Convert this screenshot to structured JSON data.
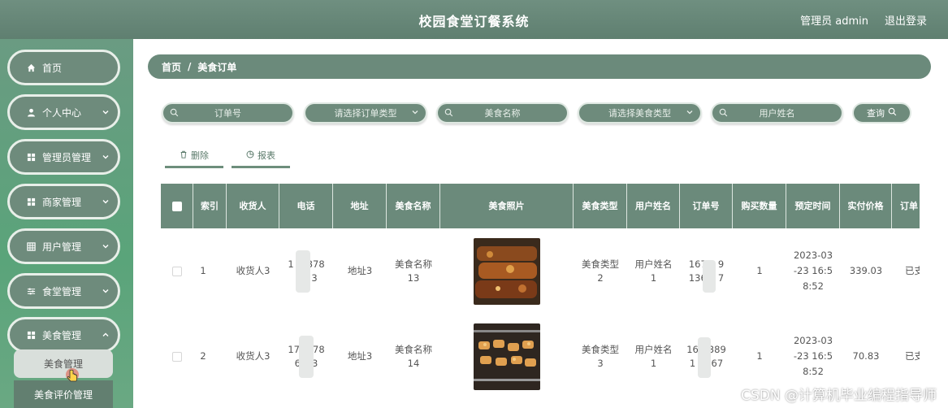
{
  "header": {
    "title": "校园食堂订餐系统",
    "admin": "管理员 admin",
    "logout": "退出登录"
  },
  "sidebar": {
    "items": [
      {
        "label": "首页",
        "icon": "home-icon"
      },
      {
        "label": "个人中心",
        "icon": "user-icon"
      },
      {
        "label": "管理员管理",
        "icon": "grid-icon"
      },
      {
        "label": "商家管理",
        "icon": "grid-icon"
      },
      {
        "label": "用户管理",
        "icon": "table-icon"
      },
      {
        "label": "食堂管理",
        "icon": "sliders-icon"
      },
      {
        "label": "美食管理",
        "icon": "grid-icon"
      }
    ],
    "sub_items": [
      "美食管理",
      "美食评价管理"
    ]
  },
  "breadcrumb": {
    "home": "首页",
    "separator": "/",
    "current": "美食订单"
  },
  "search": {
    "order_no": "订单号",
    "order_type": "请选择订单类型",
    "food_name": "美食名称",
    "food_type": "请选择美食类型",
    "user_name": "用户姓名",
    "button": "查询"
  },
  "actions": {
    "delete": "删除",
    "report": "报表"
  },
  "table": {
    "headers": [
      "索引",
      "收货人",
      "电话",
      "地址",
      "美食名称",
      "美食照片",
      "美食类型",
      "用户姓名",
      "订单号",
      "购买数量",
      "预定时间",
      "实付价格",
      "订单"
    ],
    "rows": [
      {
        "index": "1",
        "receiver": "收货人3",
        "phone": [
          "1",
          "378",
          "3"
        ],
        "address": "地址3",
        "food_name": [
          "美食名称",
          "13"
        ],
        "food_type": [
          "美食类型",
          "2"
        ],
        "user_name": [
          "用户姓名",
          "1"
        ],
        "order_no": [
          "167",
          "9",
          "136",
          "7"
        ],
        "qty": "1",
        "time": [
          "2023-03",
          "-23 16:5",
          "8:52"
        ],
        "price": "339.03",
        "status": "已支"
      },
      {
        "index": "2",
        "receiver": "收货人3",
        "phone": [
          "17",
          "78",
          "6",
          "3"
        ],
        "address": "地址3",
        "food_name": [
          "美食名称",
          "14"
        ],
        "food_type": [
          "美食类型",
          "3"
        ],
        "user_name": [
          "用户姓名",
          "1"
        ],
        "order_no": [
          "16",
          "389",
          "1",
          "567"
        ],
        "qty": "1",
        "time": [
          "2023-03",
          "-23 16:5",
          "8:52"
        ],
        "price": "70.83",
        "status": "已支"
      }
    ]
  },
  "watermark": "CSDN @计算机毕业编程指导师",
  "colors": {
    "primary": "#6b8a7b",
    "sidebar": "#5aa47a",
    "white": "#ffffff"
  }
}
